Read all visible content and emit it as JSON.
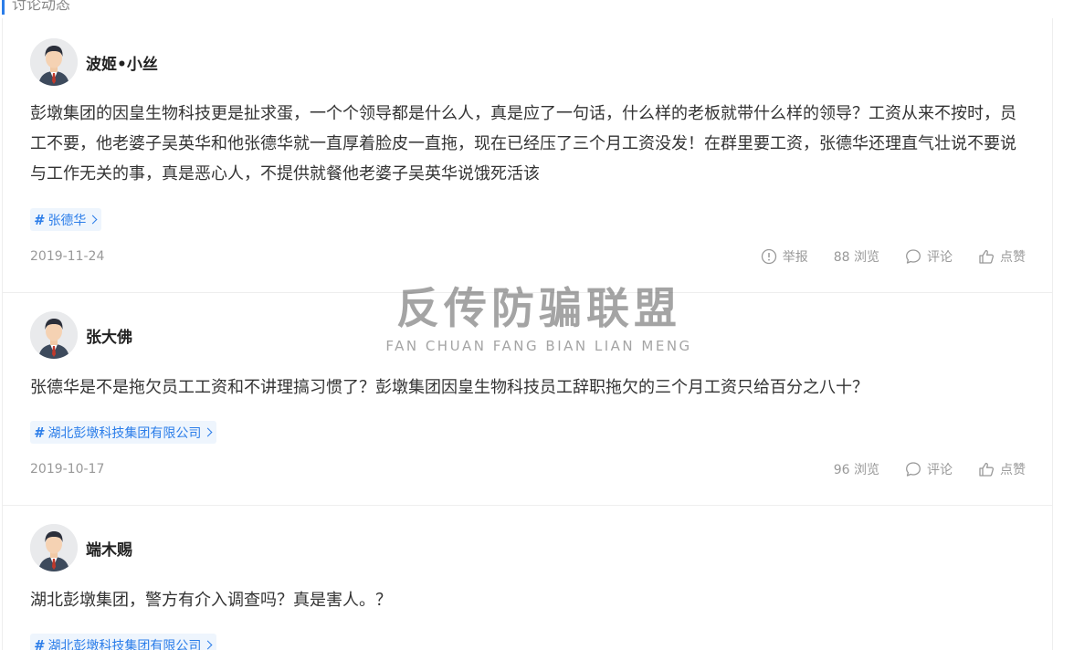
{
  "section": {
    "title": "讨论动态"
  },
  "posts": [
    {
      "author": "波姬•小丝",
      "body": "彭墩集团的因皇生物科技更是扯求蛋，一个个领导都是什么人，真是应了一句话，什么样的老板就带什么样的领导？工资从来不按时，员工不要，他老婆子吴英华和他张德华就一直厚着脸皮一直拖，现在已经压了三个月工资没发！在群里要工资，张德华还理直气壮说不要说与工作无关的事，真是恶心人，不提供就餐他老婆子吴英华说饿死活该",
      "tag": "张德华",
      "date": "2019-11-24",
      "report_label": "举报",
      "views": "88 浏览",
      "comment_label": "评论",
      "like_label": "点赞"
    },
    {
      "author": "张大佛",
      "body": "张德华是不是拖欠员工工资和不讲理搞习惯了？彭墩集团因皇生物科技员工辞职拖欠的三个月工资只给百分之八十？",
      "tag": "湖北彭墩科技集团有限公司",
      "date": "2019-10-17",
      "views": "96 浏览",
      "comment_label": "评论",
      "like_label": "点赞"
    },
    {
      "author": "端木赐",
      "body": "湖北彭墩集团，警方有介入调查吗？真是害人。？",
      "tag": "湖北彭墩科技集团有限公司"
    }
  ],
  "watermark": {
    "main": "反传防骗联盟",
    "sub": "FAN CHUAN FANG BIAN LIAN MENG"
  }
}
